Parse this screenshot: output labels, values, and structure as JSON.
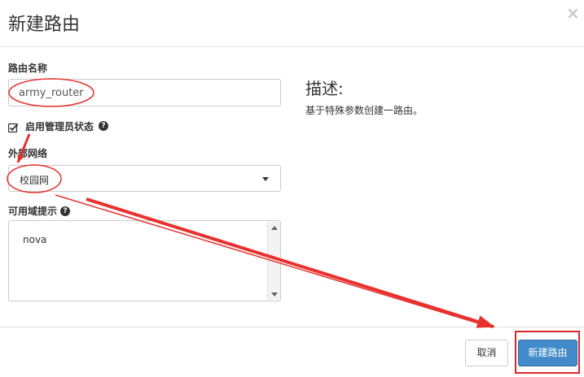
{
  "dialog": {
    "title": "新建路由",
    "close_icon": "close-icon"
  },
  "form": {
    "router_name_label": "路由名称",
    "router_name_value": "army_router",
    "admin_state_label": "启用管理员状态",
    "admin_state_checked": true,
    "external_network_label": "外部网络",
    "external_network_value": "校园网",
    "availability_zone_label": "可用域提示",
    "availability_zone_options": [
      "nova"
    ]
  },
  "description": {
    "title": "描述:",
    "text": "基于特殊参数创建一路由。"
  },
  "footer": {
    "cancel_label": "取消",
    "submit_label": "新建路由"
  },
  "annotations": {
    "color": "#e8312f"
  }
}
